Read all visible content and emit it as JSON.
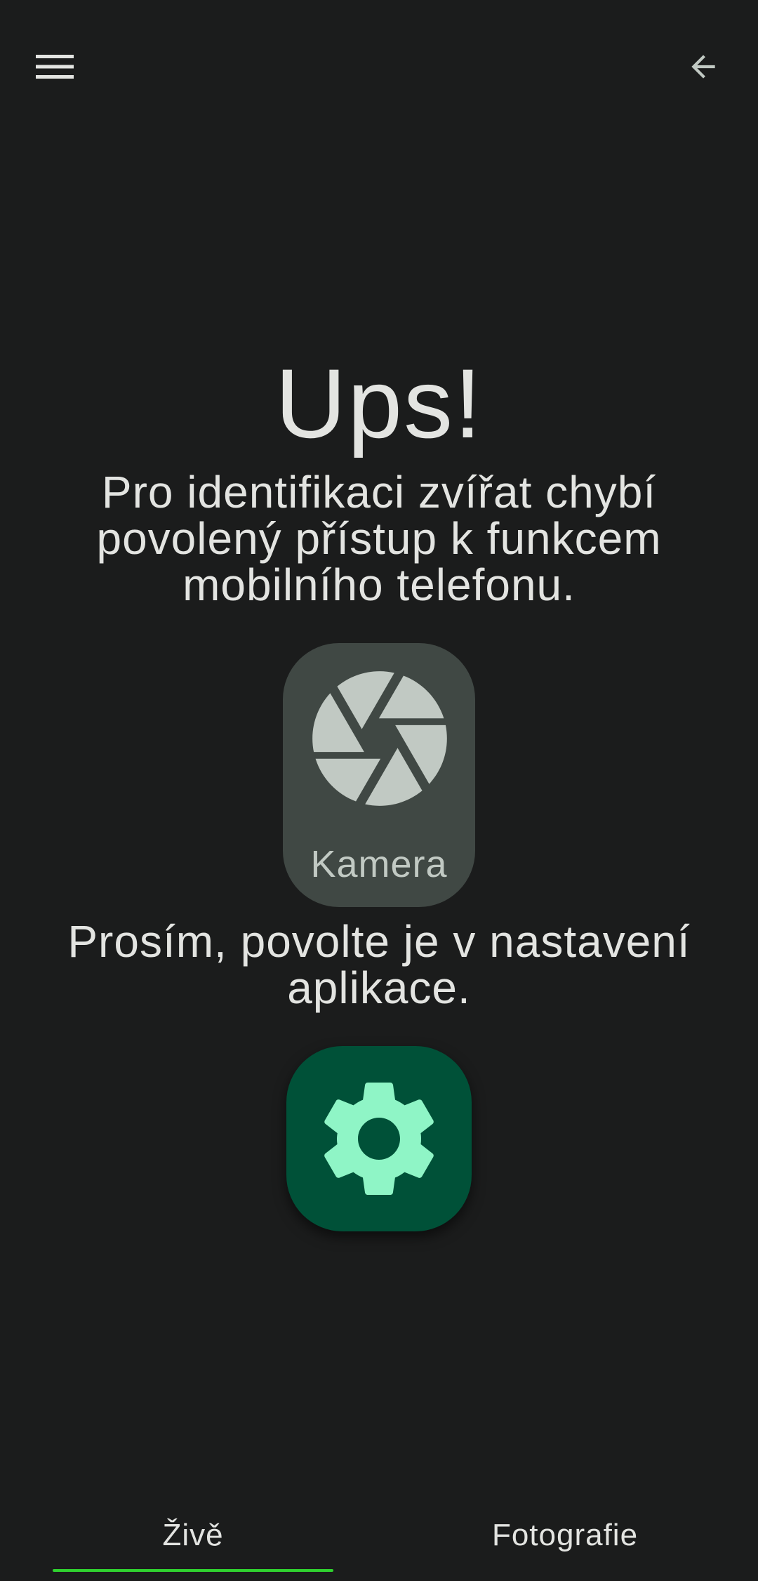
{
  "topbar": {
    "menu_icon": "menu-icon",
    "back_icon": "arrow-back-icon"
  },
  "main": {
    "title": "Ups!",
    "message": "Pro identifikaci zvířat chybí povolený přístup k funkcem mobilního telefonu.",
    "permission": {
      "icon": "camera-aperture-icon",
      "label": "Kamera"
    },
    "prompt": "Prosím, povolte je v nastavení aplikace.",
    "settings_icon": "settings-gear-icon"
  },
  "tabs": [
    {
      "label": "Živě",
      "selected": true
    },
    {
      "label": "Fotografie",
      "selected": false
    }
  ],
  "colors": {
    "background": "#1b1c1c",
    "permission_card": "#404844",
    "settings_button": "#005138",
    "settings_gear": "#8ff5c6",
    "tab_indicator": "#2fd12f"
  }
}
